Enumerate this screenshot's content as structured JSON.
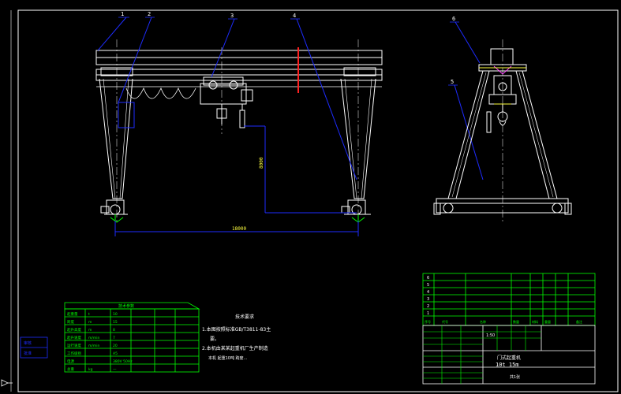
{
  "drawing": {
    "notes_title": "技术要求",
    "note_1": "1.本图按照标准GB/T3811-83主",
    "note_1b": "要。",
    "note_2": "2.本机由某某起重机厂生产制造",
    "note_2b": "本机 起重10吨 跨度...",
    "span_dim": "18000",
    "height_dim": "8000",
    "balloons": [
      "1",
      "2",
      "3",
      "4",
      "5",
      "6"
    ],
    "title_block": {
      "drawing_name": "门式起重机",
      "spec": "10t  15m",
      "scale": "1:50",
      "sheet": "共1张"
    },
    "parts_rows": [
      "6",
      "5",
      "4",
      "3",
      "2",
      "1"
    ],
    "parts_header": [
      "序号",
      "代号",
      "名称",
      "数量",
      "材料",
      "重量",
      "备注"
    ],
    "spec_title": "技术参数",
    "spec_rows": [
      [
        "起重量",
        "t",
        "10"
      ],
      [
        "跨度",
        "m",
        "15"
      ],
      [
        "起升高度",
        "m",
        "8"
      ],
      [
        "起升速度",
        "m/min",
        "7"
      ],
      [
        "运行速度",
        "m/min",
        "20"
      ],
      [
        "工作级别",
        "",
        "A5"
      ],
      [
        "电源",
        "",
        "380V 50Hz"
      ],
      [
        "总重",
        "kg",
        "—"
      ]
    ],
    "left_stamp": [
      "审核",
      "批准"
    ],
    "ucs": "Y"
  },
  "colors": {
    "bg": "#000000",
    "line": "#ffffff",
    "blue": "#1e2cff",
    "green": "#00ff00",
    "red": "#ff2020",
    "magenta": "#ff40ff",
    "yellow": "#ffff40"
  }
}
